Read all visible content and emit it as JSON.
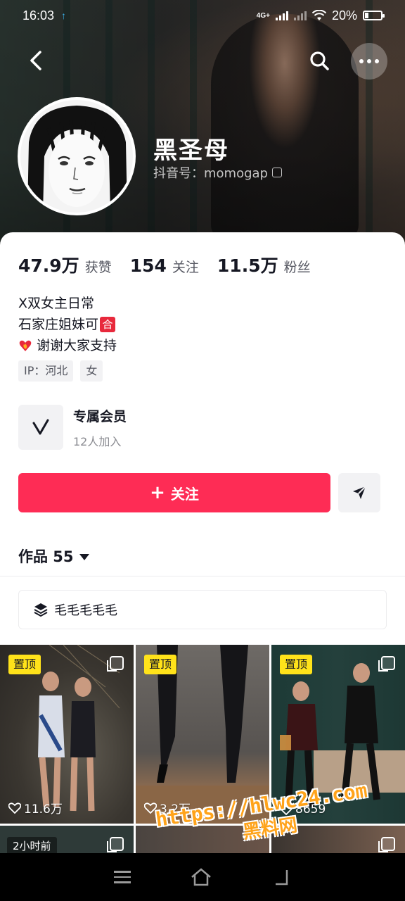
{
  "status_bar": {
    "time": "16:03",
    "network": "4G+",
    "battery": "20%"
  },
  "profile": {
    "nickname": "黑圣母",
    "account_id": "抖音号：momogap",
    "stats": [
      {
        "value": "47.9万",
        "label": "获赞"
      },
      {
        "value": "154",
        "label": "关注"
      },
      {
        "value": "11.5万",
        "label": "粉丝"
      }
    ],
    "bio": {
      "line1": "X双女主日常",
      "line2": "石家庄姐妹可",
      "line2_badge": "合",
      "line3": "谢谢大家支持"
    },
    "tags": [
      "IP：河北",
      "女"
    ]
  },
  "membership": {
    "title": "专属会员",
    "subtitle": "12人加入"
  },
  "actions": {
    "follow_label": "关注",
    "follow_plus": "+"
  },
  "works": {
    "tab_label": "作品 55",
    "collection_label": "毛毛毛毛毛"
  },
  "grid": {
    "pinned_label": "置顶",
    "items": [
      {
        "likes": "11.6万"
      },
      {
        "likes": "3.2万"
      },
      {
        "likes": "8659"
      }
    ],
    "row2_time": "2小时前"
  },
  "watermark": {
    "url": "https://hlwc24.com",
    "name": "黑料网"
  },
  "colors": {
    "accent": "#fe2c55",
    "pin_badge": "#ffe21a",
    "watermark": "#ffa31a"
  }
}
